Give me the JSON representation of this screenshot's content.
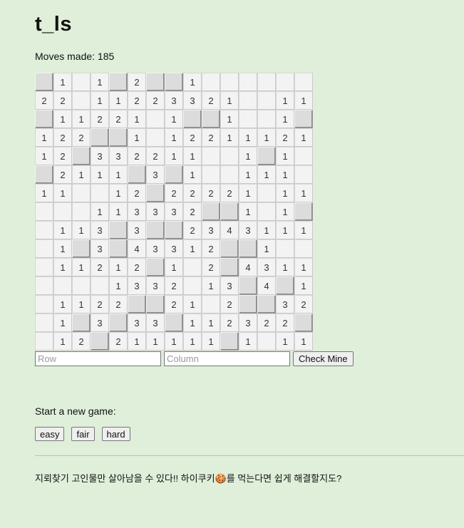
{
  "title": "t_ls",
  "moves": {
    "label": "Moves made: 185"
  },
  "board": {
    "rows": [
      [
        "#",
        "1",
        "",
        "1",
        "#",
        "2",
        "#",
        "#",
        "1",
        "",
        "",
        "",
        "",
        "",
        ""
      ],
      [
        "2",
        "2",
        "",
        "1",
        "1",
        "2",
        "2",
        "3",
        "3",
        "2",
        "1",
        "",
        "",
        "1",
        "1"
      ],
      [
        "#",
        "1",
        "1",
        "2",
        "2",
        "1",
        "",
        "1",
        "#",
        "#",
        "1",
        "",
        "",
        "1",
        "#"
      ],
      [
        "1",
        "2",
        "2",
        "#",
        "#",
        "1",
        "",
        "1",
        "2",
        "2",
        "1",
        "1",
        "1",
        "2",
        "1"
      ],
      [
        "1",
        "2",
        "#",
        "3",
        "3",
        "2",
        "2",
        "1",
        "1",
        "",
        "",
        "1",
        "#",
        "1",
        ""
      ],
      [
        "#",
        "2",
        "1",
        "1",
        "1",
        "#",
        "3",
        "#",
        "1",
        "",
        "",
        "1",
        "1",
        "1",
        ""
      ],
      [
        "1",
        "1",
        "",
        "",
        "1",
        "2",
        "#",
        "2",
        "2",
        "2",
        "2",
        "1",
        "",
        "1",
        "1"
      ],
      [
        "",
        "",
        "",
        "1",
        "1",
        "3",
        "3",
        "3",
        "2",
        "#",
        "#",
        "1",
        "",
        "1",
        "#"
      ],
      [
        "",
        "1",
        "1",
        "3",
        "#",
        "3",
        "#",
        "#",
        "2",
        "3",
        "4",
        "3",
        "1",
        "1",
        "1"
      ],
      [
        "",
        "1",
        "#",
        "3",
        "#",
        "4",
        "3",
        "3",
        "1",
        "2",
        "#",
        "#",
        "1",
        "",
        ""
      ],
      [
        "",
        "1",
        "1",
        "2",
        "1",
        "2",
        "#",
        "1",
        "",
        "2",
        "#",
        "4",
        "3",
        "1",
        "1"
      ],
      [
        "",
        "",
        "",
        "",
        "1",
        "3",
        "3",
        "2",
        "",
        "1",
        "3",
        "#",
        "4",
        "#",
        "1"
      ],
      [
        "",
        "1",
        "1",
        "2",
        "2",
        "#",
        "#",
        "2",
        "1",
        "",
        "2",
        "#",
        "#",
        "3",
        "2"
      ],
      [
        "",
        "1",
        "#",
        "3",
        "#",
        "3",
        "3",
        "#",
        "1",
        "1",
        "2",
        "3",
        "2",
        "2",
        "#"
      ],
      [
        "",
        "1",
        "2",
        "#",
        "2",
        "1",
        "1",
        "1",
        "1",
        "1",
        "#",
        "1",
        "",
        "1",
        "1"
      ]
    ]
  },
  "controls": {
    "row_placeholder": "Row",
    "column_placeholder": "Column",
    "check_label": "Check Mine"
  },
  "new_game": {
    "label": "Start a new game:",
    "easy": "easy",
    "fair": "fair",
    "hard": "hard"
  },
  "footer": {
    "text": "지뢰찾기 고인물만 살아남을 수 있다!! 하이쿠키🍪를 먹는다면 쉽게 해결할지도?"
  }
}
